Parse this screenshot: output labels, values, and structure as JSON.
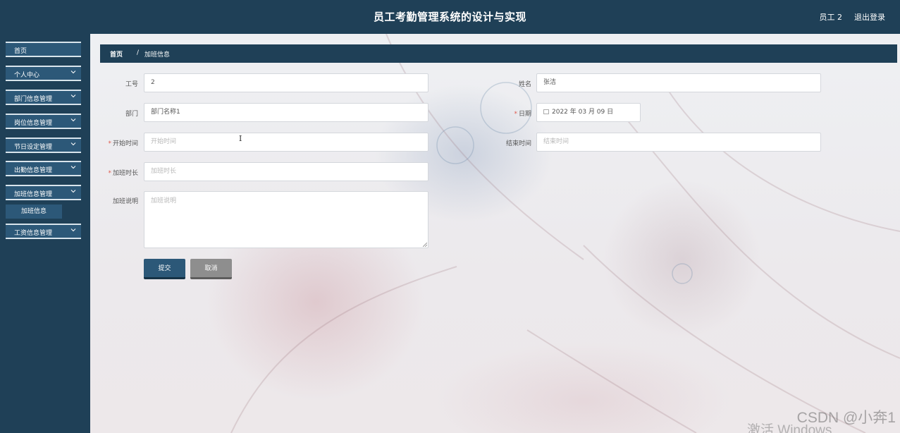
{
  "header": {
    "title": "员工考勤管理系统的设计与实现",
    "user": "员工 2",
    "logout": "退出登录"
  },
  "sidebar": {
    "items": [
      {
        "label": "首页",
        "expandable": false
      },
      {
        "label": "个人中心",
        "expandable": true
      },
      {
        "label": "部门信息管理",
        "expandable": true
      },
      {
        "label": "岗位信息管理",
        "expandable": true
      },
      {
        "label": "节日设定管理",
        "expandable": true
      },
      {
        "label": "出勤信息管理",
        "expandable": true
      },
      {
        "label": "加班信息管理",
        "expandable": true
      },
      {
        "label": "工资信息管理",
        "expandable": true
      }
    ],
    "subitem": "加班信息"
  },
  "breadcrumb": {
    "home": "首页",
    "separator": "/",
    "current": "加班信息"
  },
  "form": {
    "employee_no": {
      "label": "工号",
      "value": "2"
    },
    "name": {
      "label": "姓名",
      "value": "张洁"
    },
    "department": {
      "label": "部门",
      "value": "部门名称1"
    },
    "date": {
      "label": "日期",
      "required": true,
      "value": "2022 年 03 月 09 日"
    },
    "start_time": {
      "label": "开始时间",
      "required": true,
      "placeholder": "开始时间"
    },
    "end_time": {
      "label": "结束时间",
      "placeholder": "结束时间"
    },
    "duration": {
      "label": "加班时长",
      "required": true,
      "placeholder": "加班时长"
    },
    "description": {
      "label": "加班说明",
      "placeholder": "加班说明"
    },
    "submit": "提交",
    "cancel": "取消"
  },
  "overlay": {
    "watermark": "CSDN @小奔1",
    "activation": "激活 Windows"
  },
  "colors": {
    "primary": "#1f4057",
    "menu": "#2c5878",
    "required": "#e05a4e",
    "cancel": "#8e8e8e"
  }
}
